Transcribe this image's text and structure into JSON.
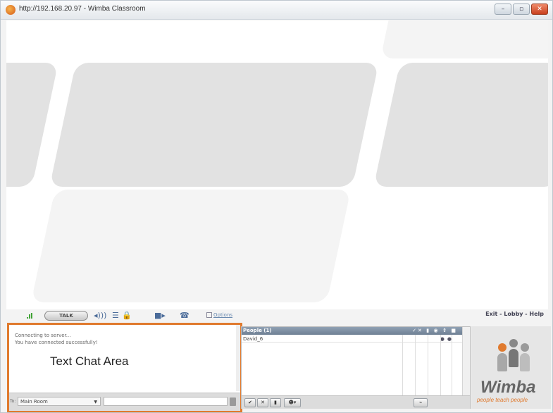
{
  "window": {
    "title": "http://192.168.20.97 - Wimba Classroom",
    "controls": [
      "minimize-icon",
      "maximize-icon",
      "close-icon"
    ]
  },
  "audio_bar": {
    "talk_label": "TALK",
    "options_label": "Options",
    "links": "Exit - Lobby - Help"
  },
  "chat": {
    "log": [
      "Connecting to server...",
      "You have connected successfully!"
    ],
    "area_label": "Text Chat Area",
    "to_label": "To:",
    "room": "Main Room",
    "input_value": ""
  },
  "people": {
    "header": "People (1)",
    "rows": [
      {
        "name": "David_6"
      }
    ]
  },
  "logo": {
    "name": "Wimba",
    "tagline": "people teach people"
  },
  "colors": {
    "highlight": "#e07a2e",
    "panel_header": "#7f90a4",
    "tile": "#e2e2e2"
  }
}
